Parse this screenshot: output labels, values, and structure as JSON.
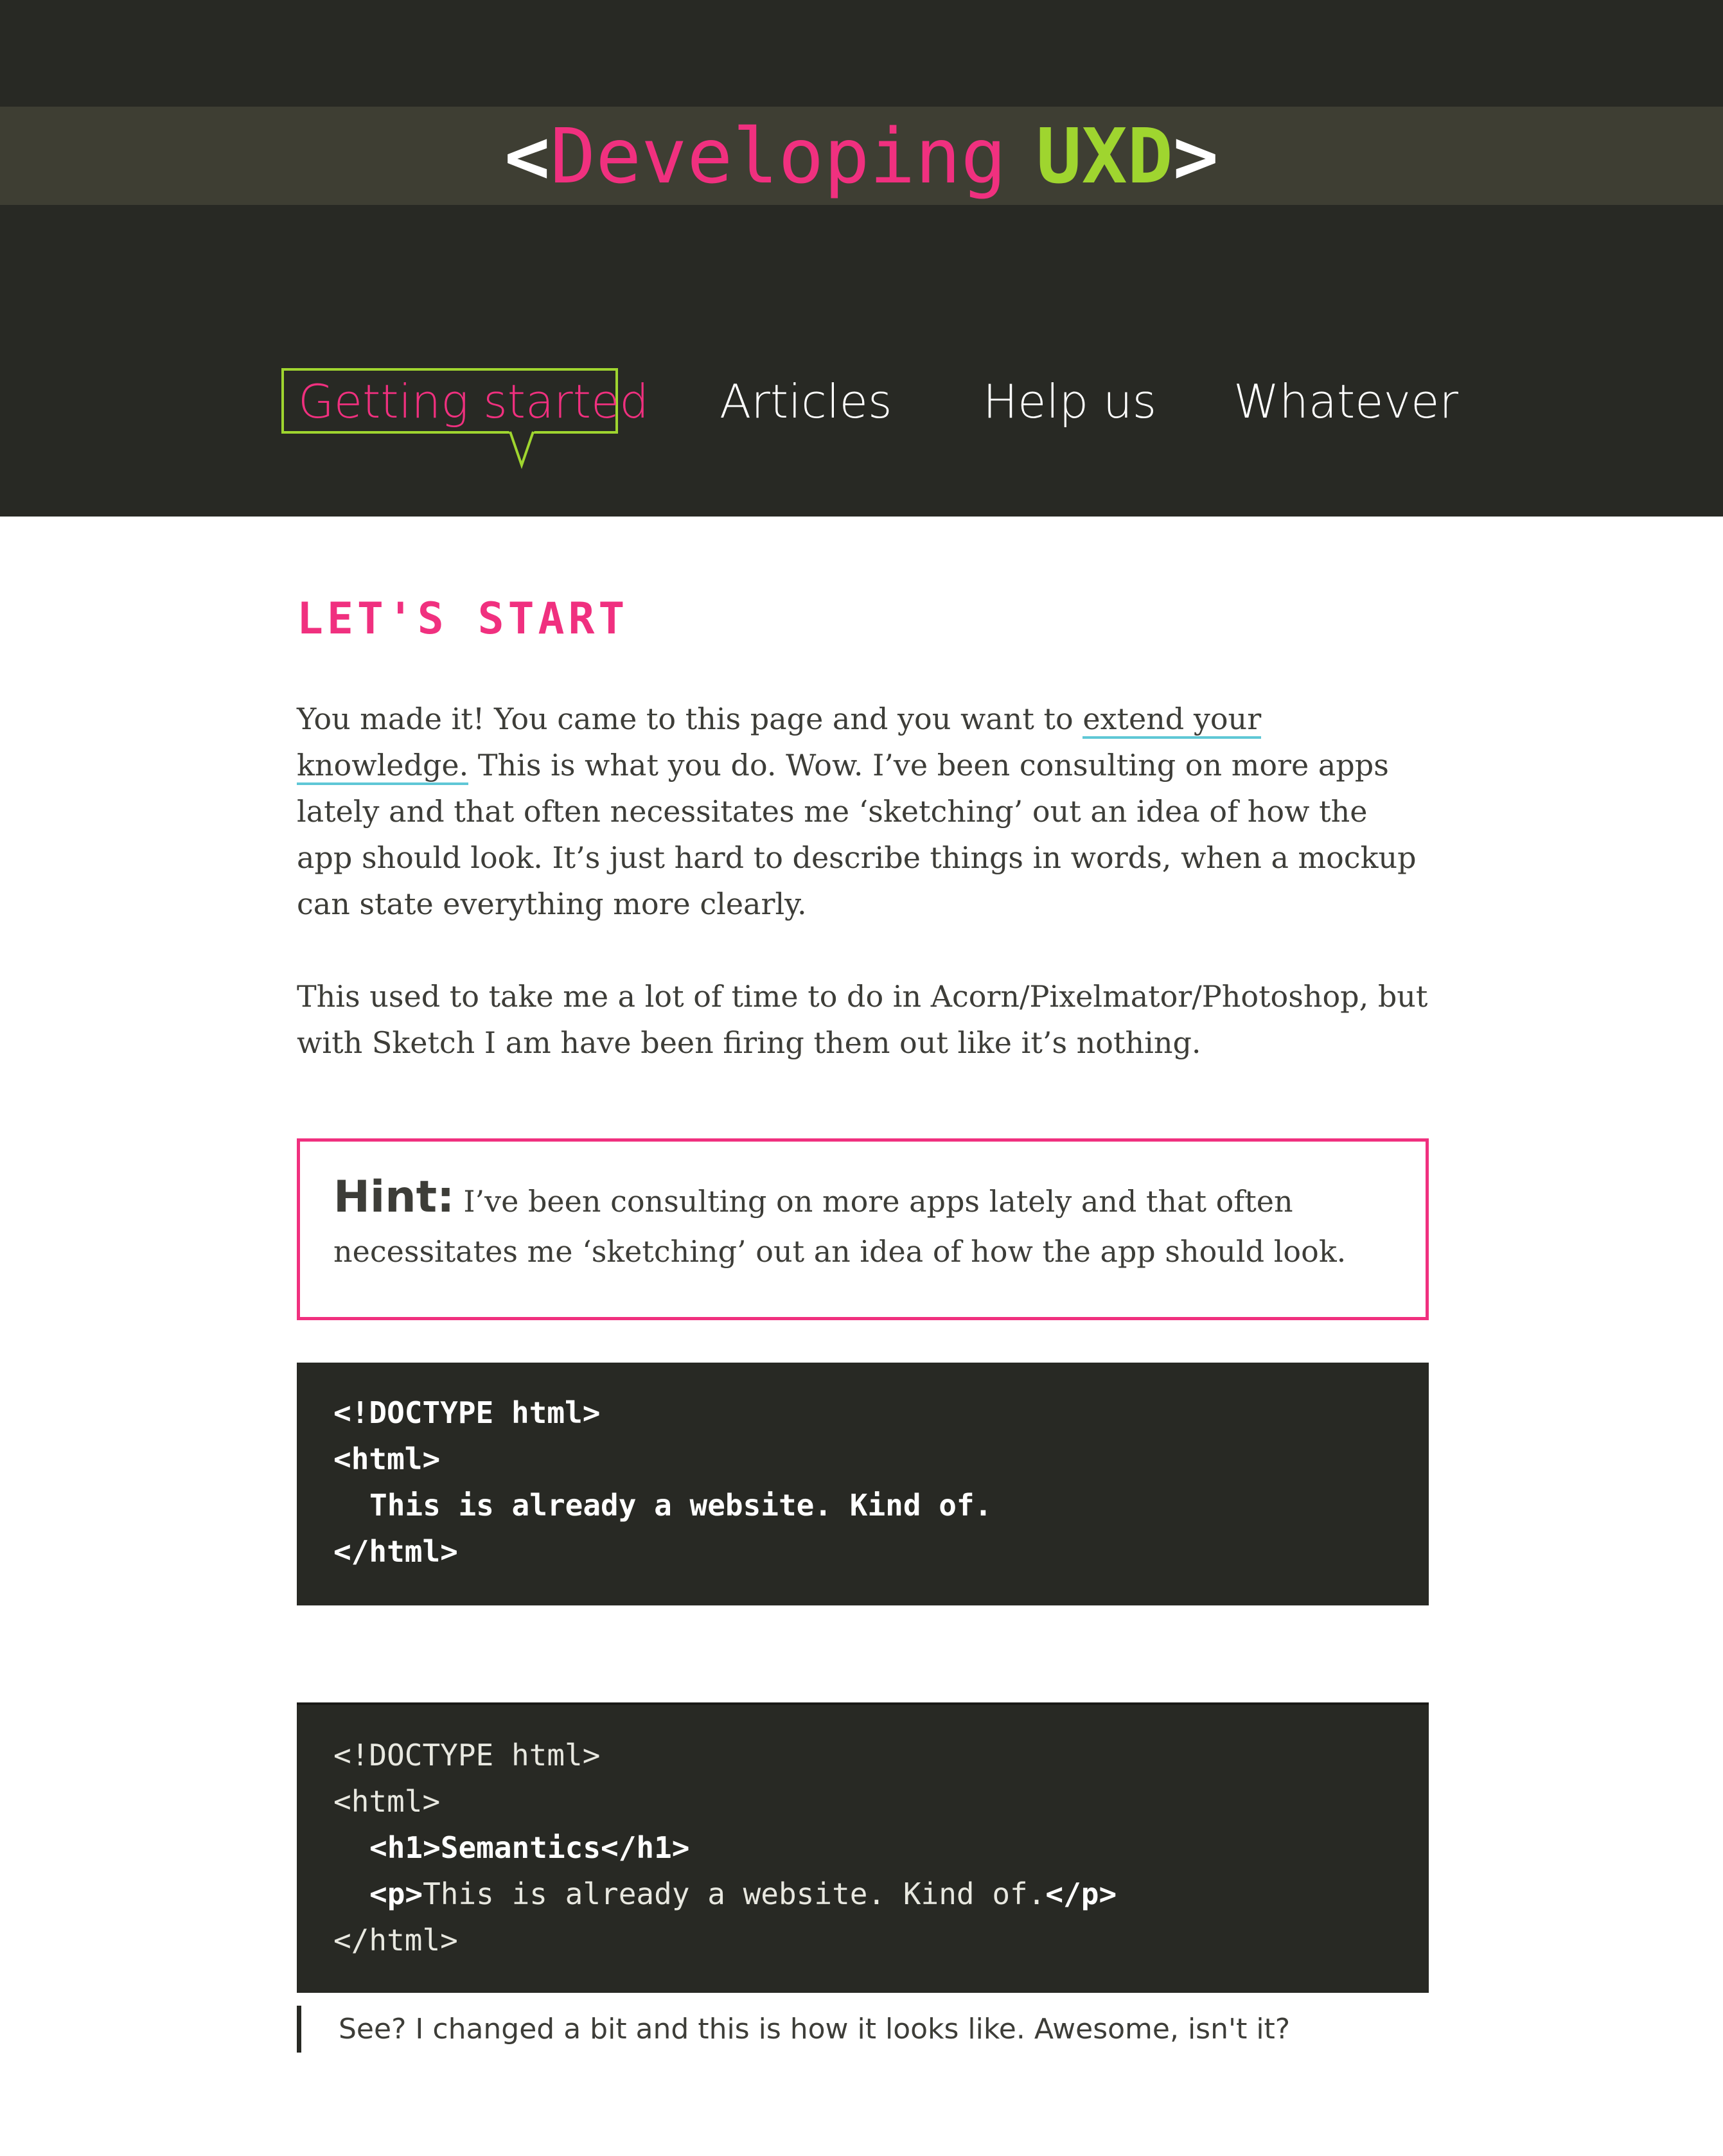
{
  "site": {
    "logo_open": "<",
    "logo_main": "Developing",
    "logo_accent": "UXD",
    "logo_close": ">"
  },
  "nav": {
    "items": [
      {
        "label": "Getting started",
        "active": true
      },
      {
        "label": "Articles",
        "active": false
      },
      {
        "label": "Help us",
        "active": false
      },
      {
        "label": "Whatever",
        "active": false
      }
    ]
  },
  "main": {
    "title": "LET'S START",
    "intro": {
      "before_link": "You made it! You came to this page and you want to ",
      "link_text": "extend your knowledge.",
      "after_link": " This is what you do. Wow. I’ve been consulting on more apps lately and that often necessitates me ‘sketching’ out an idea of how the app should look. It’s just hard to describe things in words, when a mockup can state everything more clearly."
    },
    "paragraph2": "This used to take me a lot of time to do in Acorn/Pixelmator/Photoshop, but with Sketch I am have been firing them out like it’s nothing.",
    "hint": {
      "label": "Hint:",
      "text": "I’ve been consulting on more apps lately and that often necessitates me ‘sketching’ out an idea of how the app should look."
    },
    "code1": {
      "lines": [
        "<!DOCTYPE html>",
        "<html>",
        "This is already a website. Kind of.",
        "</html>"
      ]
    },
    "code2": {
      "doctype": "<!DOCTYPE html>",
      "html_open": "<html>",
      "h1_line": "<h1>Semantics</h1>",
      "p_open": "<p>",
      "p_text": "This is already a website. Kind of.",
      "p_close": "</p>",
      "html_close": "</html>"
    },
    "caption": "See? I changed a bit and this is how it looks like. Awesome, isn't it?"
  },
  "colors": {
    "header_bg": "#282924",
    "band_bg": "#3e3e33",
    "pink": "#f0307f",
    "green": "#9fd52f",
    "link_underline": "#5fc7d6",
    "text": "#3d3d38"
  }
}
